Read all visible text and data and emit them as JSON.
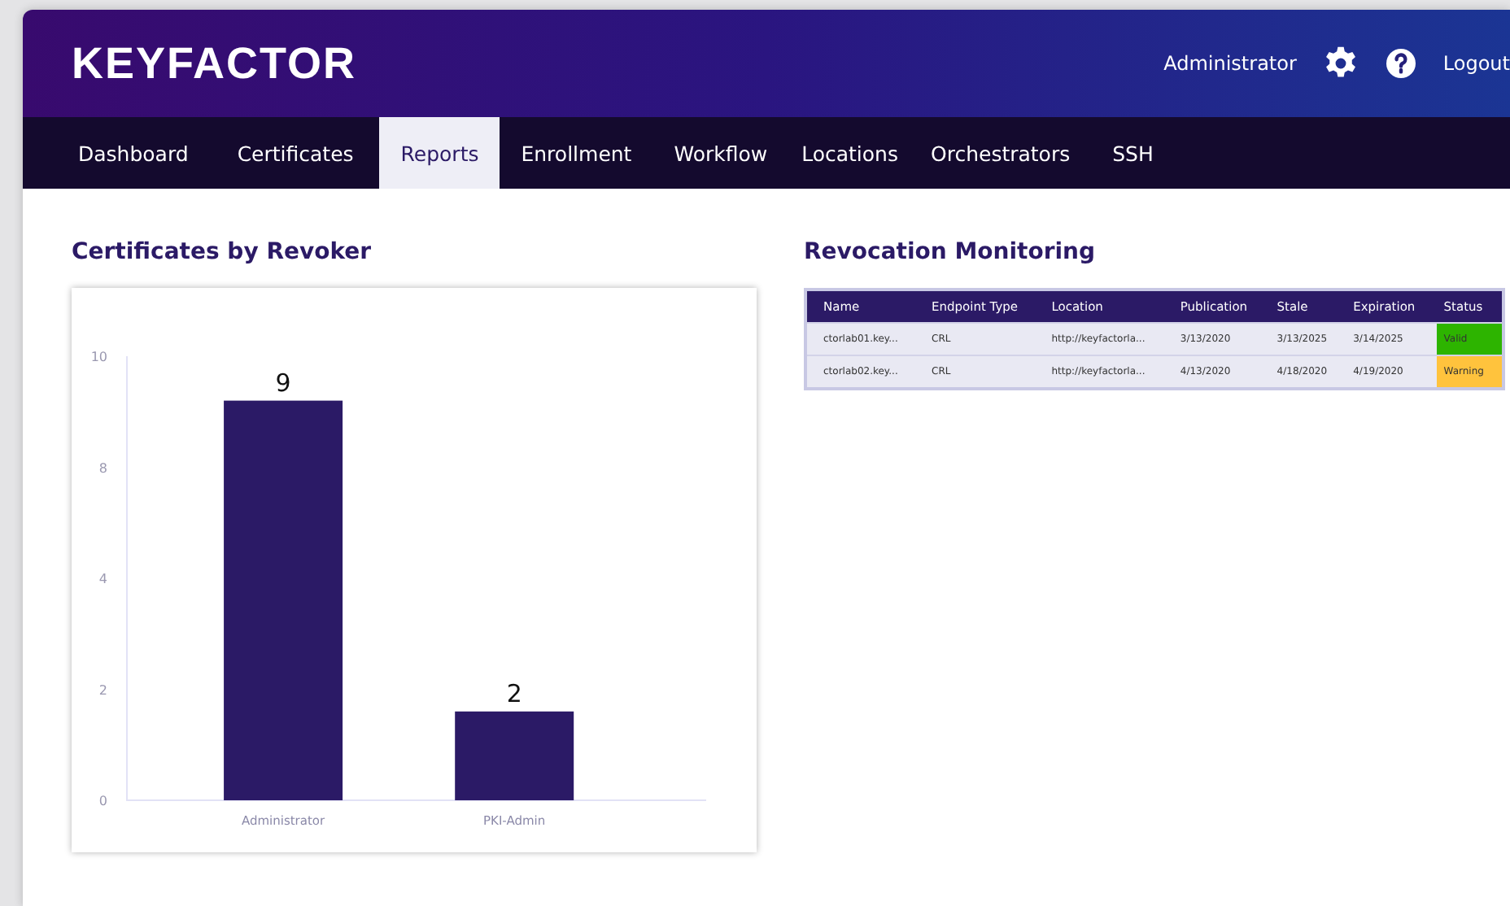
{
  "header": {
    "logo": "KEYFACTOR",
    "user": "Administrator",
    "logout": "Logout"
  },
  "tabs": [
    {
      "label": "Dashboard",
      "selected": false
    },
    {
      "label": "Certificates",
      "selected": false
    },
    {
      "label": "Reports",
      "selected": true
    },
    {
      "label": "Enrollment",
      "selected": false
    },
    {
      "label": "Workflow",
      "selected": false
    },
    {
      "label": "Locations",
      "selected": false
    },
    {
      "label": "Orchestrators",
      "selected": false
    },
    {
      "label": "SSH",
      "selected": false
    }
  ],
  "revoker_panel": {
    "title": "Certificates by Revoker",
    "chart_data": {
      "type": "bar",
      "categories": [
        "Administrator",
        "PKI-Admin"
      ],
      "series": [
        {
          "color": "#2b1a66",
          "values": [
            9,
            2
          ]
        }
      ],
      "ylim": [
        0,
        10
      ],
      "data_labels": true
    },
    "y_axis_labels": [
      "10",
      "8",
      "4",
      "2",
      "0"
    ]
  },
  "monitoring_panel": {
    "title": "Revocation Monitoring",
    "columns": [
      "Name",
      "Endpoint Type",
      "Location",
      "Publication",
      "Stale",
      "Expiration",
      "Status"
    ],
    "rows": [
      {
        "cells": [
          "ctorlab01.key...",
          "CRL",
          "http://keyfactorla...",
          "3/13/2020",
          "3/13/2025",
          "3/14/2025"
        ],
        "status": {
          "label": "Valid",
          "color": "#2db400"
        }
      },
      {
        "cells": [
          "ctorlab02.key...",
          "CRL",
          "http://keyfactorla...",
          "4/13/2020",
          "4/18/2020",
          "4/19/2020"
        ],
        "status": {
          "label": "Warning",
          "color": "#ffc33d"
        }
      }
    ]
  }
}
